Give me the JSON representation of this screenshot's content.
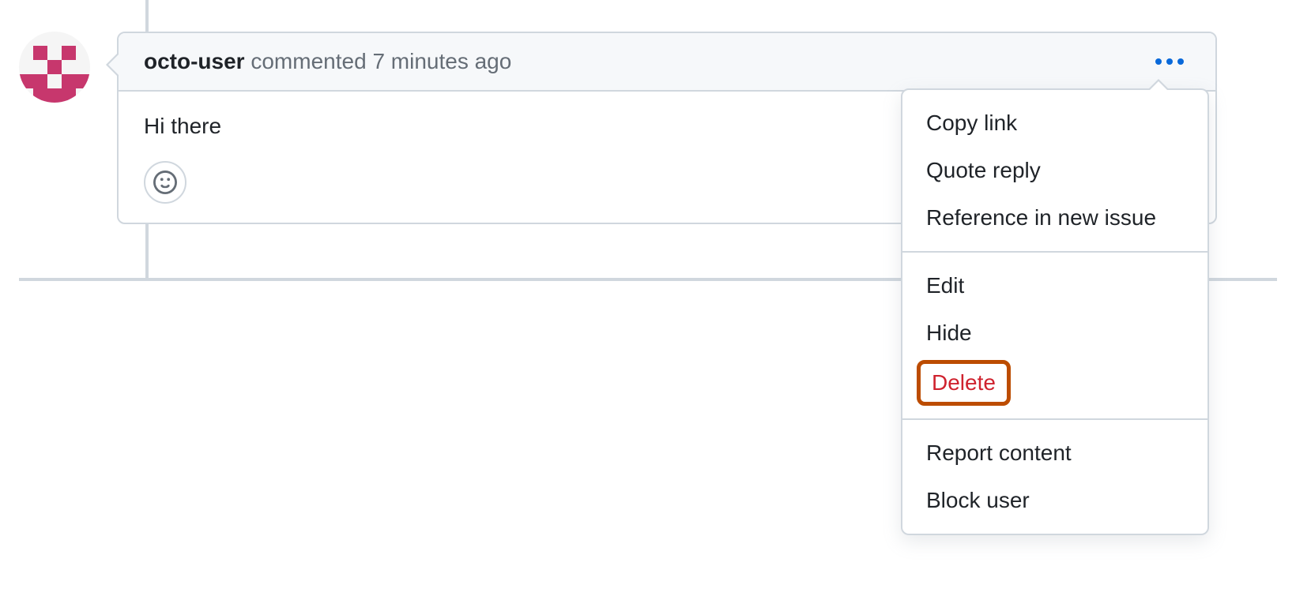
{
  "comment": {
    "username": "octo-user",
    "action_label": "commented",
    "timestamp": "7 minutes ago",
    "body": "Hi there"
  },
  "menu": {
    "copy_link": "Copy link",
    "quote_reply": "Quote reply",
    "reference_issue": "Reference in new issue",
    "edit": "Edit",
    "hide": "Hide",
    "delete": "Delete",
    "report": "Report content",
    "block": "Block user"
  },
  "icons": {
    "kebab": "kebab-horizontal-icon",
    "smiley": "smiley-icon"
  }
}
